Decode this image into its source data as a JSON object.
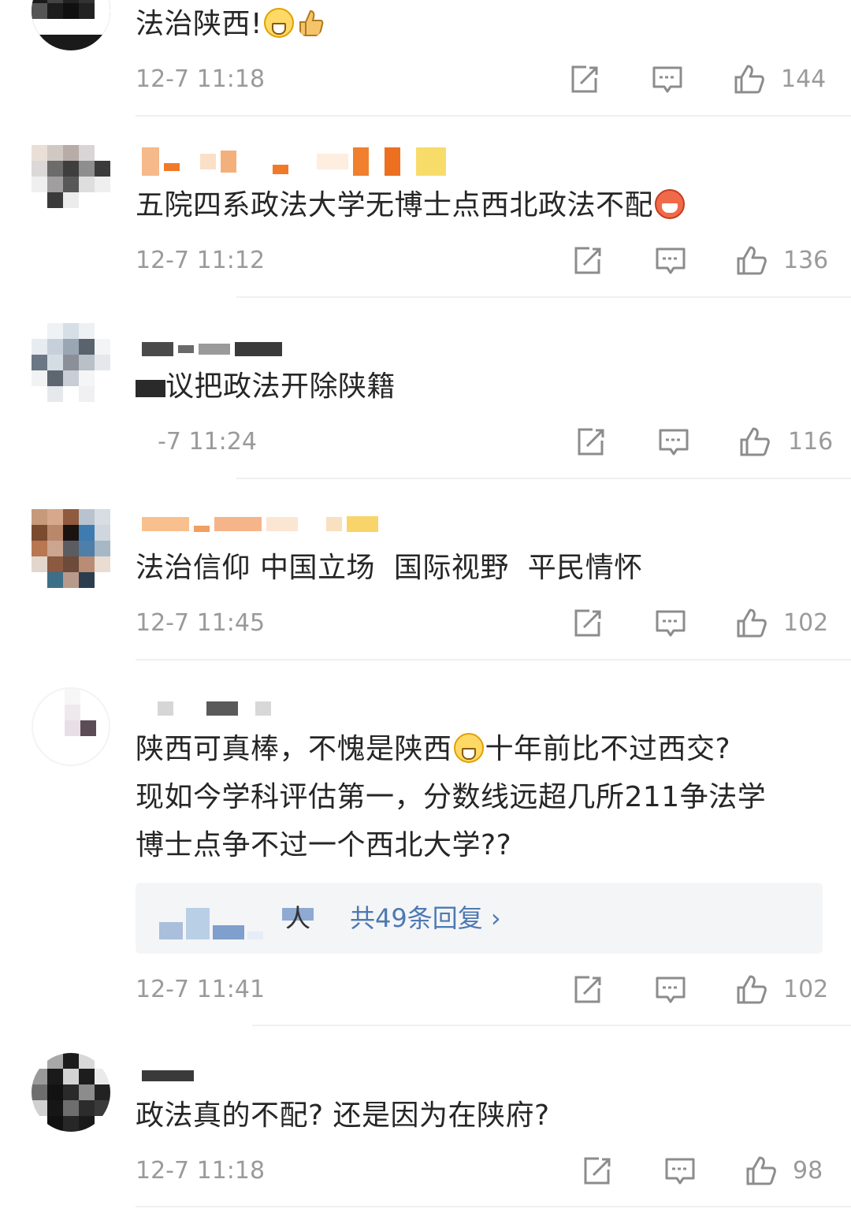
{
  "comments": [
    {
      "text": "法治陕西!",
      "time": "12-7 11:18",
      "likes": "144"
    },
    {
      "text": "五院四系政法大学无博士点西北政法不配",
      "time": "12-7 11:12",
      "likes": "136"
    },
    {
      "text": "议把政法开除陕籍",
      "time": "-7 11:24",
      "likes": "116"
    },
    {
      "text": "法治信仰 中国立场  国际视野  平民情怀",
      "time": "12-7 11:45",
      "likes": "102"
    },
    {
      "text_a": "陕西可真棒，不愧是陕西",
      "text_b": "十年前比不过西交?",
      "text_line2": "现如今学科评估第一，分数线远超几所211争法学",
      "text_line3": "博士点争不过一个西北大学??",
      "reply_person": "人",
      "reply_link": "共49条回复 ›",
      "time": "12-7 11:41",
      "likes": "102"
    },
    {
      "text": "政法真的不配? 还是因为在陕府?",
      "time": "12-7 11:18",
      "likes": "98"
    }
  ],
  "icons": {
    "share": "share-icon",
    "comment": "comment-icon",
    "like": "thumbs-up-icon",
    "emoji_grin": "grin-emoji-icon",
    "emoji_thumb": "thumbs-up-emoji-icon",
    "emoji_red": "laugh-emoji-icon"
  },
  "colors": {
    "text": "#262626",
    "meta": "#9a9a9a",
    "link": "#4d79b3",
    "reply_bg": "#f4f5f7",
    "divider": "#f0f0f0"
  }
}
